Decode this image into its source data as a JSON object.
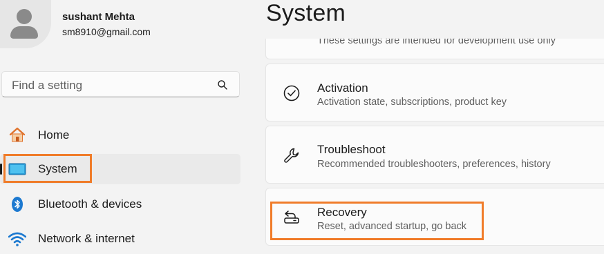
{
  "user": {
    "name": "sushant Mehta",
    "email": "sm8910@gmail.com"
  },
  "search": {
    "placeholder": "Find a setting",
    "icon": "search-icon"
  },
  "nav": [
    {
      "label": "Home",
      "icon": "home-icon",
      "selected": false
    },
    {
      "label": "System",
      "icon": "system-display-icon",
      "selected": true
    },
    {
      "label": "Bluetooth & devices",
      "icon": "bluetooth-icon",
      "selected": false
    },
    {
      "label": "Network & internet",
      "icon": "wifi-icon",
      "selected": false
    }
  ],
  "main": {
    "title": "System",
    "cards": [
      {
        "title": "",
        "desc": "These settings are intended for development use only"
      },
      {
        "title": "Activation",
        "desc": "Activation state, subscriptions, product key",
        "icon": "activation-check-icon"
      },
      {
        "title": "Troubleshoot",
        "desc": "Recommended troubleshooters, preferences, history",
        "icon": "wrench-icon"
      },
      {
        "title": "Recovery",
        "desc": "Reset, advanced startup, go back",
        "icon": "recovery-icon"
      }
    ]
  },
  "colors": {
    "accent_highlight": "#f07c2a",
    "background": "#f3f3f3",
    "card": "#fbfbfb",
    "system_icon": "#2a9fd8",
    "bluetooth_icon": "#1c79d0"
  }
}
